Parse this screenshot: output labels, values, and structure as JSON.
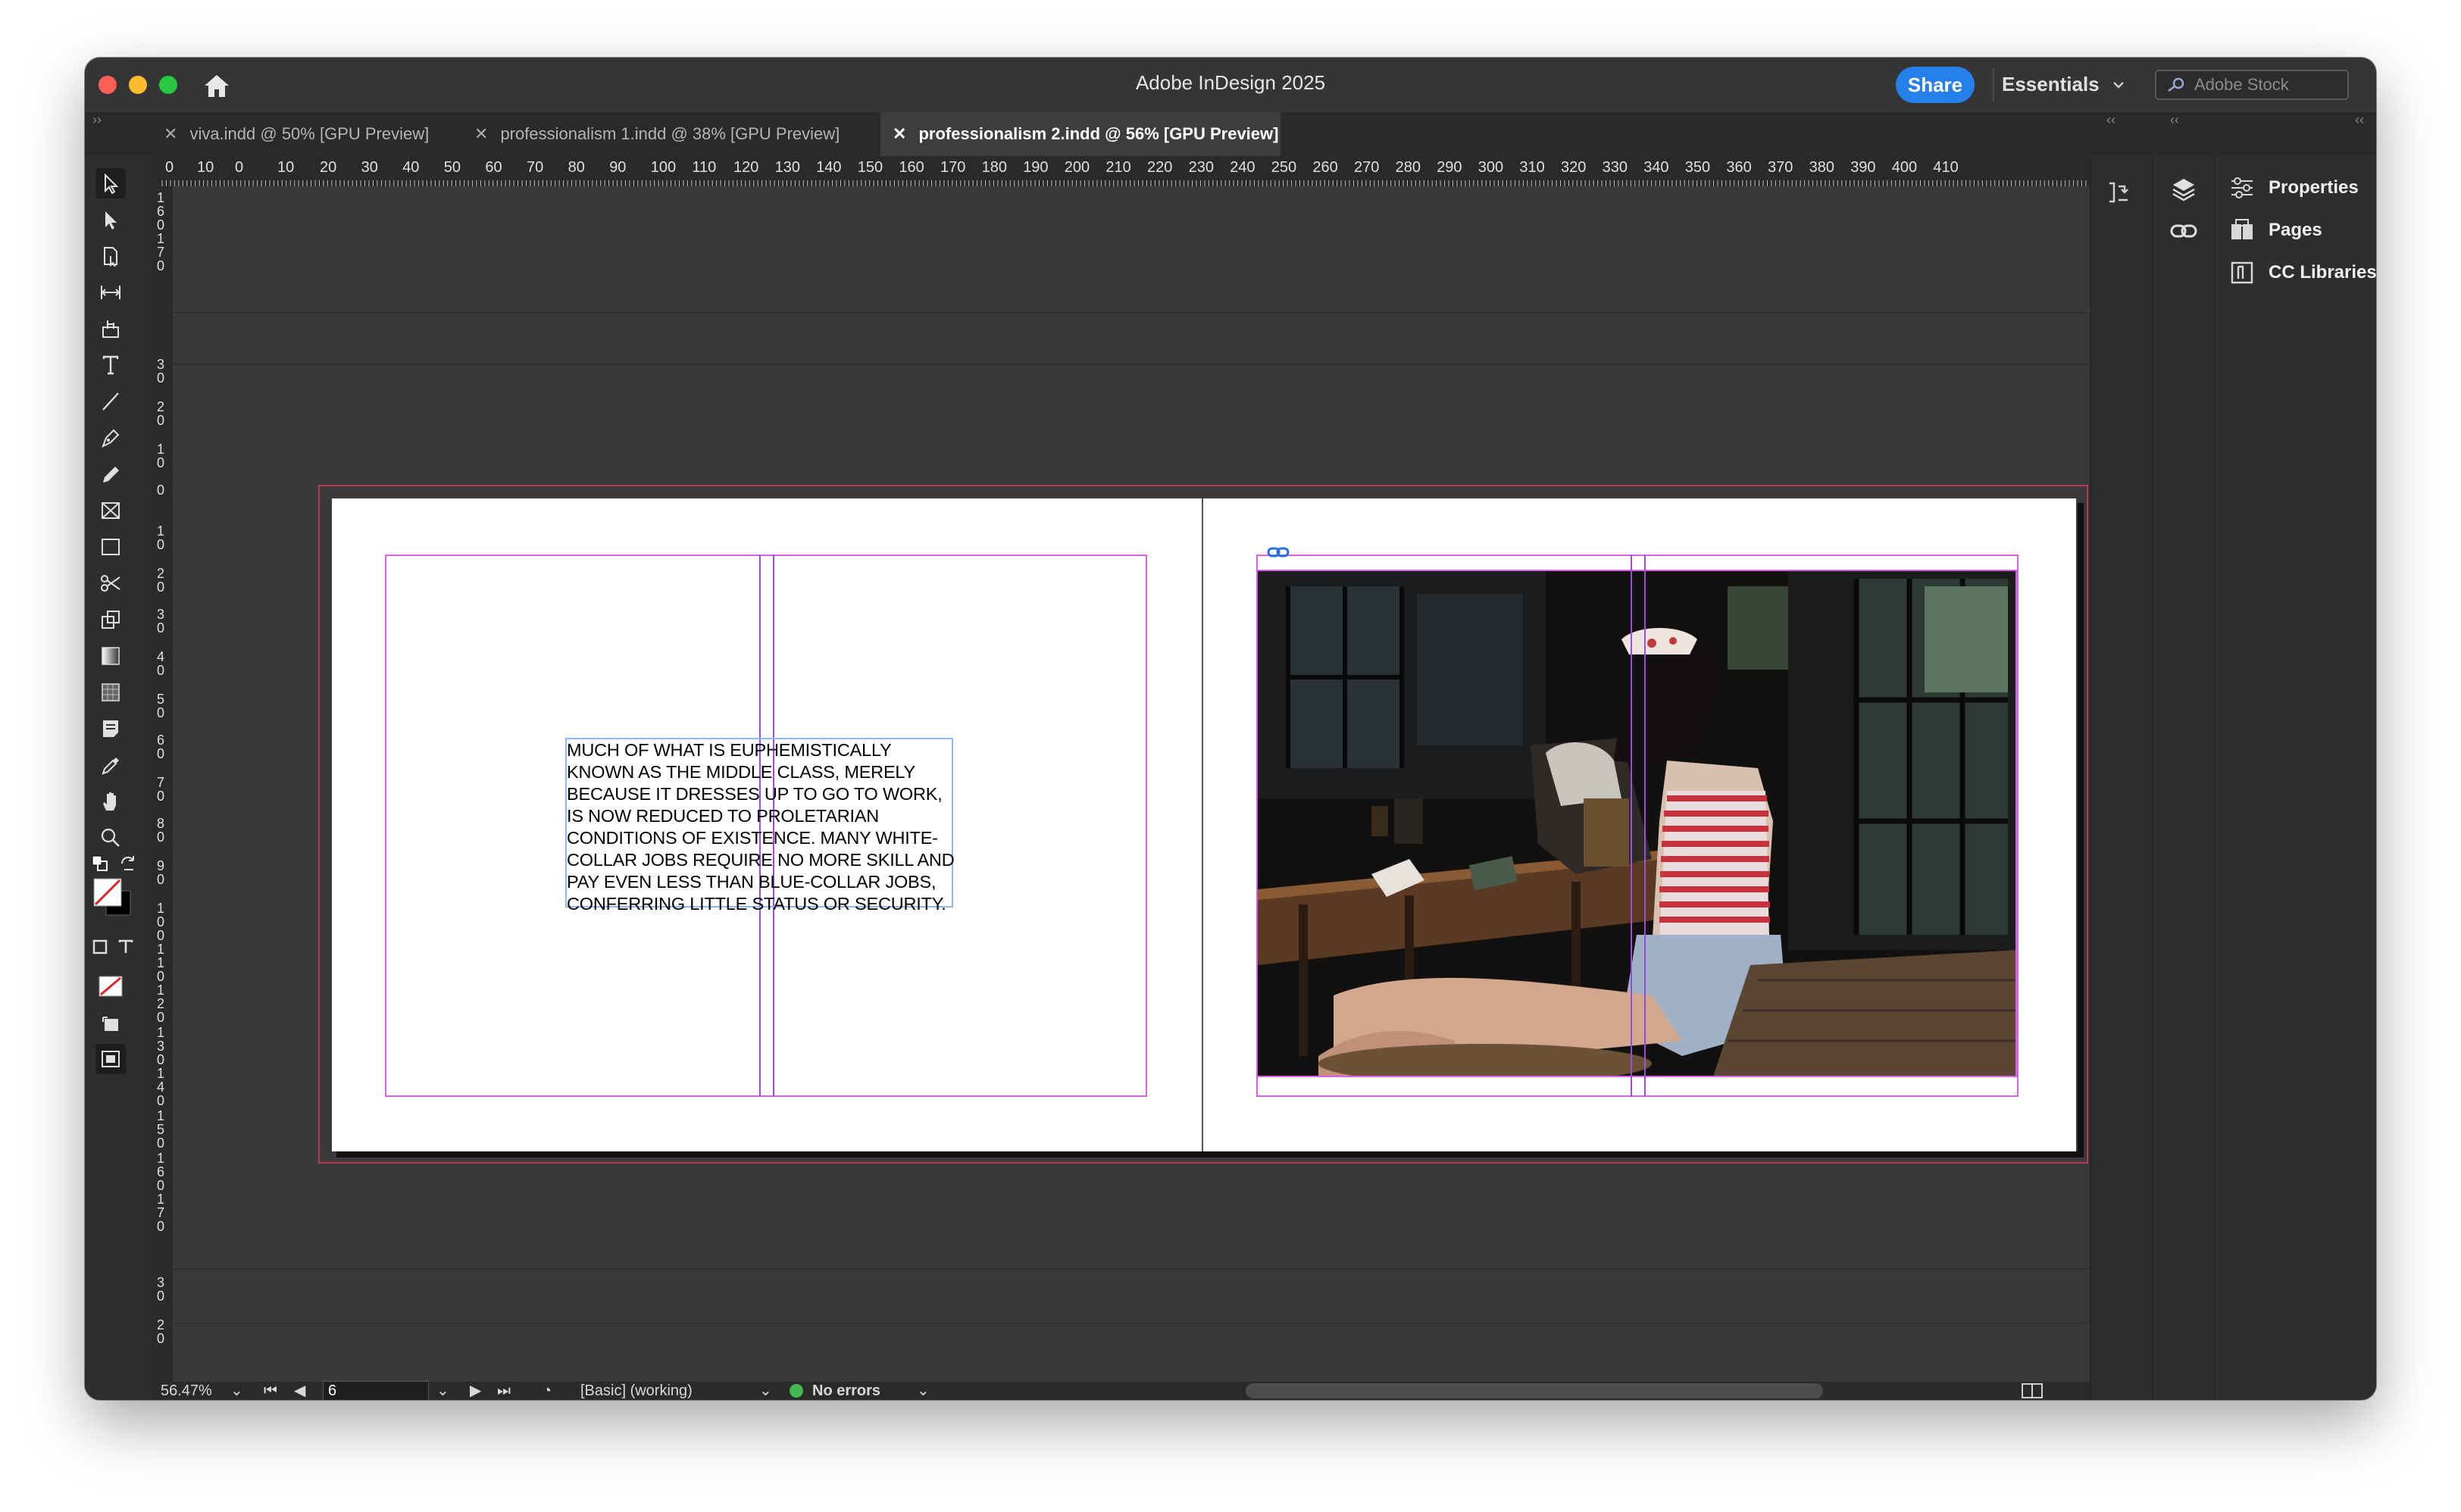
{
  "app": {
    "title": "Adobe InDesign 2025",
    "share_label": "Share",
    "workspace_label": "Essentials",
    "stock_placeholder": "Adobe Stock"
  },
  "tabs": [
    {
      "label": "viva.indd @ 50% [GPU Preview]",
      "active": false
    },
    {
      "label": "professionalism 1.indd @ 38% [GPU Preview]",
      "active": false
    },
    {
      "label": "professionalism 2.indd @ 56% [GPU Preview]",
      "active": true
    }
  ],
  "ruler": {
    "h_labels": [
      "0",
      "10",
      "0",
      "10",
      "20",
      "30",
      "40",
      "50",
      "60",
      "70",
      "80",
      "90",
      "100",
      "110",
      "120",
      "130",
      "140",
      "150",
      "160",
      "170",
      "180",
      "190",
      "200",
      "210",
      "220",
      "230",
      "240",
      "250",
      "260",
      "270",
      "280",
      "290",
      "300",
      "310",
      "320",
      "330",
      "340",
      "350",
      "360",
      "370",
      "380",
      "390",
      "400",
      "410"
    ],
    "v_labels": [
      "160",
      "170",
      "30",
      "20",
      "10",
      "0",
      "10",
      "20",
      "30",
      "40",
      "50",
      "60",
      "70",
      "80",
      "90",
      "100",
      "110",
      "120",
      "130",
      "140",
      "150",
      "160",
      "170",
      "30",
      "20"
    ]
  },
  "document": {
    "body_text": "MUCH OF WHAT IS EUPHEMISTICALLY KNOWN AS THE MIDDLE CLASS, MERELY BECAUSE IT DRESSES UP TO GO TO WORK, IS NOW REDUCED TO PROLETARIAN CONDITIONS OF EXISTENCE. MANY WHITE-COLLAR JOBS REQUIRE NO MORE SKILL AND PAY EVEN LESS THAN BLUE-COLLAR JOBS, CONFERRING LITTLE STATUS OR SECURITY."
  },
  "status": {
    "zoom": "56.47%",
    "page": "6",
    "preflight_profile": "[Basic] (working)",
    "errors": "No errors"
  },
  "panels": {
    "items": [
      {
        "label": "Properties",
        "icon": "properties-icon"
      },
      {
        "label": "Pages",
        "icon": "pages-icon"
      },
      {
        "label": "CC Libraries",
        "icon": "cc-libraries-icon"
      }
    ]
  },
  "colors": {
    "accent": "#2680eb",
    "margin_guide": "#d760e4",
    "bleed_guide": "#b53a4e",
    "status_ok": "#3fb950"
  }
}
